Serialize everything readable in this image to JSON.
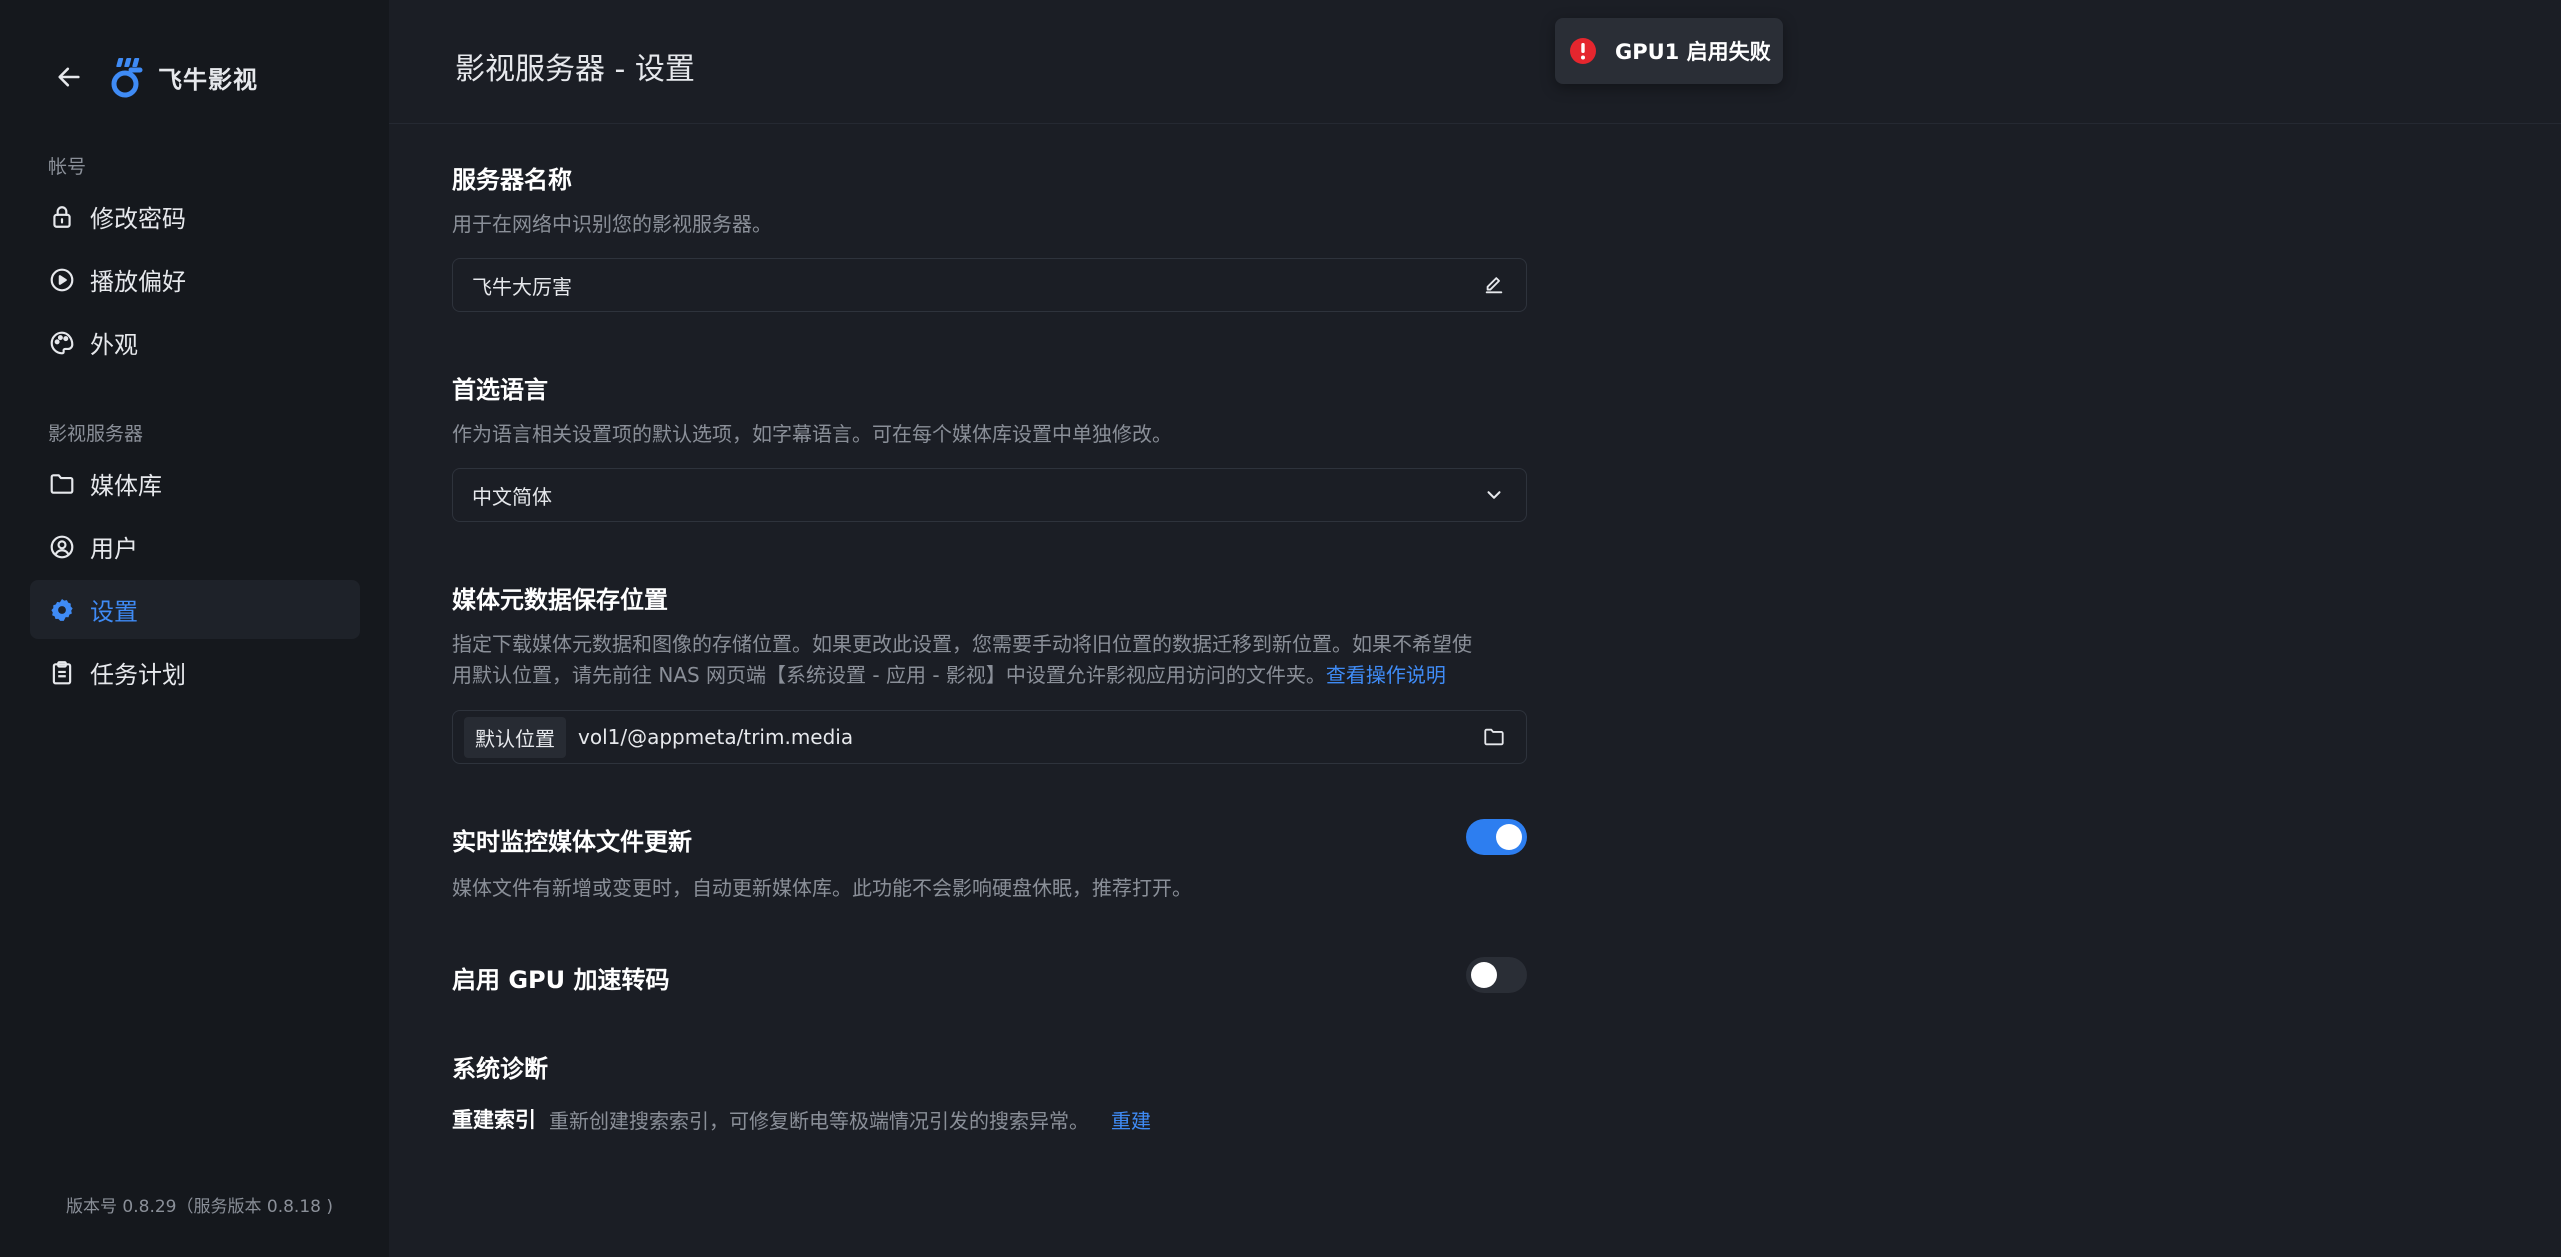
{
  "app": {
    "brand_name": "飞牛影视",
    "colors": {
      "accent": "#3f8bf5",
      "toggle_on": "#2d7ef0",
      "error": "#e5262e"
    }
  },
  "sidebar": {
    "account_label": "帐号",
    "account_items": [
      {
        "label": "修改密码",
        "icon": "lock-icon"
      },
      {
        "label": "播放偏好",
        "icon": "play-circle-icon"
      },
      {
        "label": "外观",
        "icon": "palette-icon"
      }
    ],
    "server_label": "影视服务器",
    "server_items": [
      {
        "label": "媒体库",
        "icon": "folder-icon"
      },
      {
        "label": "用户",
        "icon": "user-circle-icon"
      },
      {
        "label": "设置",
        "icon": "gear-icon",
        "active": true
      },
      {
        "label": "任务计划",
        "icon": "clipboard-icon"
      }
    ],
    "version": "版本号 0.8.29（服务版本 0.8.18 )"
  },
  "header": {
    "title": "影视服务器 - 设置"
  },
  "toast": {
    "text": "GPU1 启用失败",
    "icon": "error-icon"
  },
  "settings": {
    "server_name": {
      "title": "服务器名称",
      "desc": "用于在网络中识别您的影视服务器。",
      "value": "飞牛大厉害"
    },
    "language": {
      "title": "首选语言",
      "desc": "作为语言相关设置项的默认选项，如字幕语言。可在每个媒体库设置中单独修改。",
      "value": "中文简体"
    },
    "metadata": {
      "title": "媒体元数据保存位置",
      "desc_line1": "指定下载媒体元数据和图像的存储位置。如果更改此设置，您需要手动将旧位置的数据迁移到新位置。如果不希望使",
      "desc_line2": "用默认位置，请先前往 NAS 网页端【系统设置 - 应用 - 影视】中设置允许影视应用访问的文件夹。",
      "link": "查看操作说明",
      "tag": "默认位置",
      "path": "vol1/@appmeta/trim.media"
    },
    "monitor": {
      "title": "实时监控媒体文件更新",
      "desc": "媒体文件有新增或变更时，自动更新媒体库。此功能不会影响硬盘休眠，推荐打开。",
      "enabled": true
    },
    "gpu": {
      "title": "启用 GPU 加速转码",
      "enabled": false
    },
    "diagnosis": {
      "title": "系统诊断",
      "rebuild_label": "重建索引",
      "rebuild_desc": "重新创建搜索索引，可修复断电等极端情况引发的搜索异常。",
      "rebuild_link": "重建"
    }
  }
}
